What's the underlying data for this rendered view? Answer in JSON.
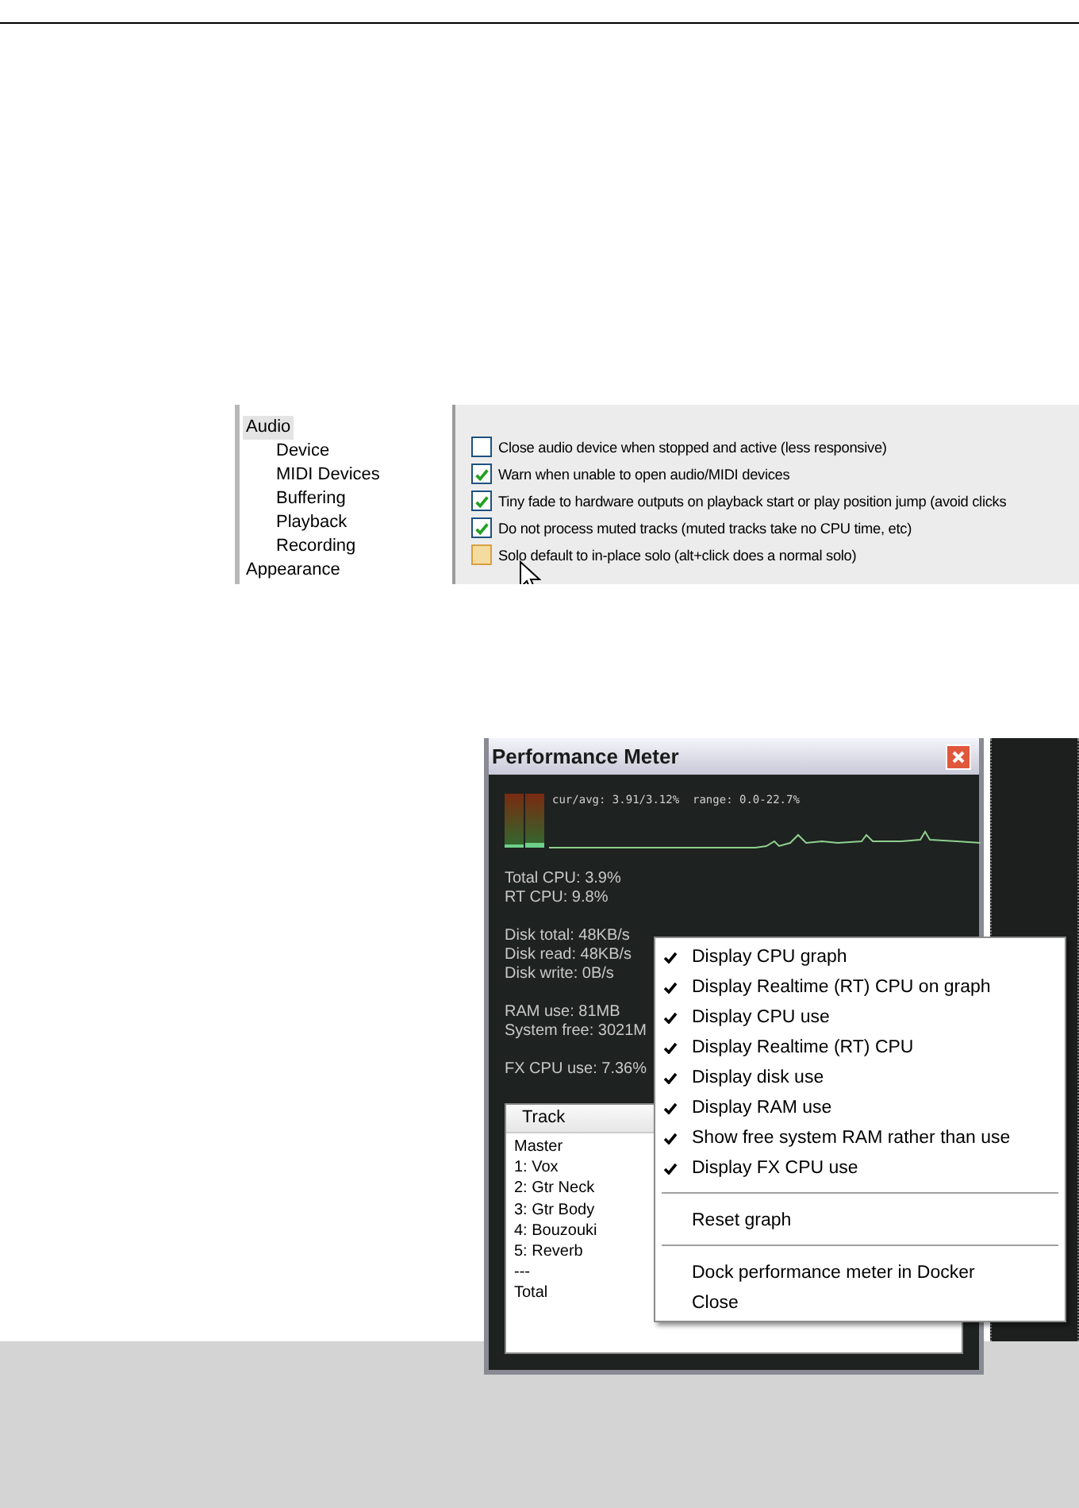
{
  "preferences_screenshot": {
    "sidebar": {
      "items": [
        {
          "label": "Audio",
          "selected": true,
          "children": [
            {
              "label": "Device",
              "selected": false
            },
            {
              "label": "MIDI Devices",
              "selected": false
            },
            {
              "label": "Buffering",
              "selected": false
            },
            {
              "label": "Playback",
              "selected": false
            },
            {
              "label": "Recording",
              "selected": false
            }
          ]
        },
        {
          "label": "Appearance",
          "selected": false
        }
      ]
    },
    "options": [
      {
        "label": "Close audio device when stopped and active (less responsive)",
        "checked": false,
        "hover": false
      },
      {
        "label": "Warn when unable to open audio/MIDI devices",
        "checked": true,
        "hover": false
      },
      {
        "label": "Tiny fade to hardware outputs on playback start or play position jump (avoid clicks",
        "checked": true,
        "hover": false
      },
      {
        "label": "Do not process muted tracks (muted tracks take no CPU time, etc)",
        "checked": true,
        "hover": false
      },
      {
        "label": "Solo default to in-place solo (alt+click does a normal solo)",
        "checked": false,
        "hover": true
      }
    ]
  },
  "performance_meter": {
    "title": "Performance Meter",
    "graph_caption": "cur/avg: 3.91/3.12%  range: 0.0-22.7%",
    "stats": [
      [
        "Total CPU: 3.9%",
        "RT CPU: 9.8%"
      ],
      [
        "Disk total: 48KB/s",
        "Disk read: 48KB/s",
        "Disk write: 0B/s"
      ],
      [
        "RAM use: 81MB",
        "System free: 3021M"
      ],
      [
        "FX CPU use: 7.36%"
      ]
    ],
    "track_list": {
      "header": "Track",
      "rows": [
        "Master",
        "1: Vox",
        "2: Gtr Neck",
        "3: Gtr Body",
        "4: Bouzouki",
        "5: Reverb",
        "---",
        "Total"
      ]
    },
    "context_menu": {
      "items": [
        {
          "kind": "check",
          "label": "Display CPU graph",
          "checked": true
        },
        {
          "kind": "check",
          "label": "Display Realtime (RT) CPU on graph",
          "checked": true
        },
        {
          "kind": "check",
          "label": "Display CPU use",
          "checked": true
        },
        {
          "kind": "check",
          "label": "Display Realtime (RT) CPU",
          "checked": true
        },
        {
          "kind": "check",
          "label": "Display disk use",
          "checked": true
        },
        {
          "kind": "check",
          "label": "Display RAM use",
          "checked": true
        },
        {
          "kind": "check",
          "label": "Show free system RAM rather than use",
          "checked": true
        },
        {
          "kind": "check",
          "label": "Display FX CPU use",
          "checked": true
        },
        {
          "kind": "separator"
        },
        {
          "kind": "command",
          "label": "Reset graph"
        },
        {
          "kind": "separator"
        },
        {
          "kind": "command",
          "label": "Dock performance meter in Docker"
        },
        {
          "kind": "command",
          "label": "Close"
        }
      ]
    }
  }
}
